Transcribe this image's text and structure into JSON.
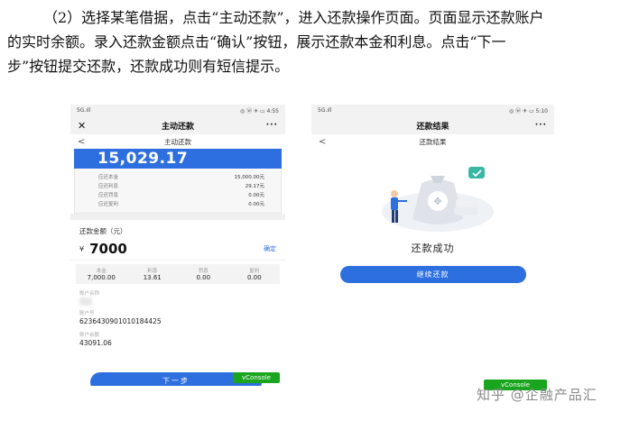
{
  "paragraph": {
    "line1": "（2）选择某笔借据，点击“主动还款”，进入还款操作页面。页面显示还款账户",
    "line2": "的实时余额。录入还款金额点击“确认”按钮，展示还款本金和利息。点击“下一",
    "line3": "步”按钮提交还款，还款成功则有短信提示。"
  },
  "phone_left": {
    "status_left": "5G.ıll",
    "status_right": "◎ ⓦ ✈ ▭ 4:55",
    "title": "主动还款",
    "close_icon": "close-icon",
    "more": "···",
    "subtitle": "主动还款",
    "back": "<",
    "balance": "15,029.17",
    "details": [
      {
        "label": "应还本金",
        "value": "15,000.00元"
      },
      {
        "label": "应还利息",
        "value": "29.17元"
      },
      {
        "label": "应还罚息",
        "value": "0.00元"
      },
      {
        "label": "应还复利",
        "value": "0.00元"
      }
    ],
    "amount_label": "还款金额（元）",
    "currency": "¥",
    "amount": "7000",
    "confirm": "确定",
    "breakdown": [
      {
        "label": "本金",
        "value": "7,000.00"
      },
      {
        "label": "利息",
        "value": "13.61"
      },
      {
        "label": "罚息",
        "value": "0.00"
      },
      {
        "label": "复利",
        "value": "0.00"
      }
    ],
    "account_name_label": "账户名称",
    "account_no_label": "账户号",
    "account_no": "6236430901010184425",
    "balance_label": "账户余额",
    "account_balance": "43091.06",
    "next_button": "下一步",
    "vconsole": "vConsole"
  },
  "phone_right": {
    "status_left": "5G.ıll",
    "status_right": "◎ ⓦ ✈ ▭ 5:10",
    "title": "还款结果",
    "more": "···",
    "subtitle": "还款结果",
    "back": "<",
    "success": "还款成功",
    "continue_button": "继续还款",
    "vconsole": "vConsole"
  },
  "watermark": {
    "text": "知乎 @企融产品汇"
  },
  "colors": {
    "accent": "#2e6fe0",
    "vconsole": "#1aa51f"
  }
}
